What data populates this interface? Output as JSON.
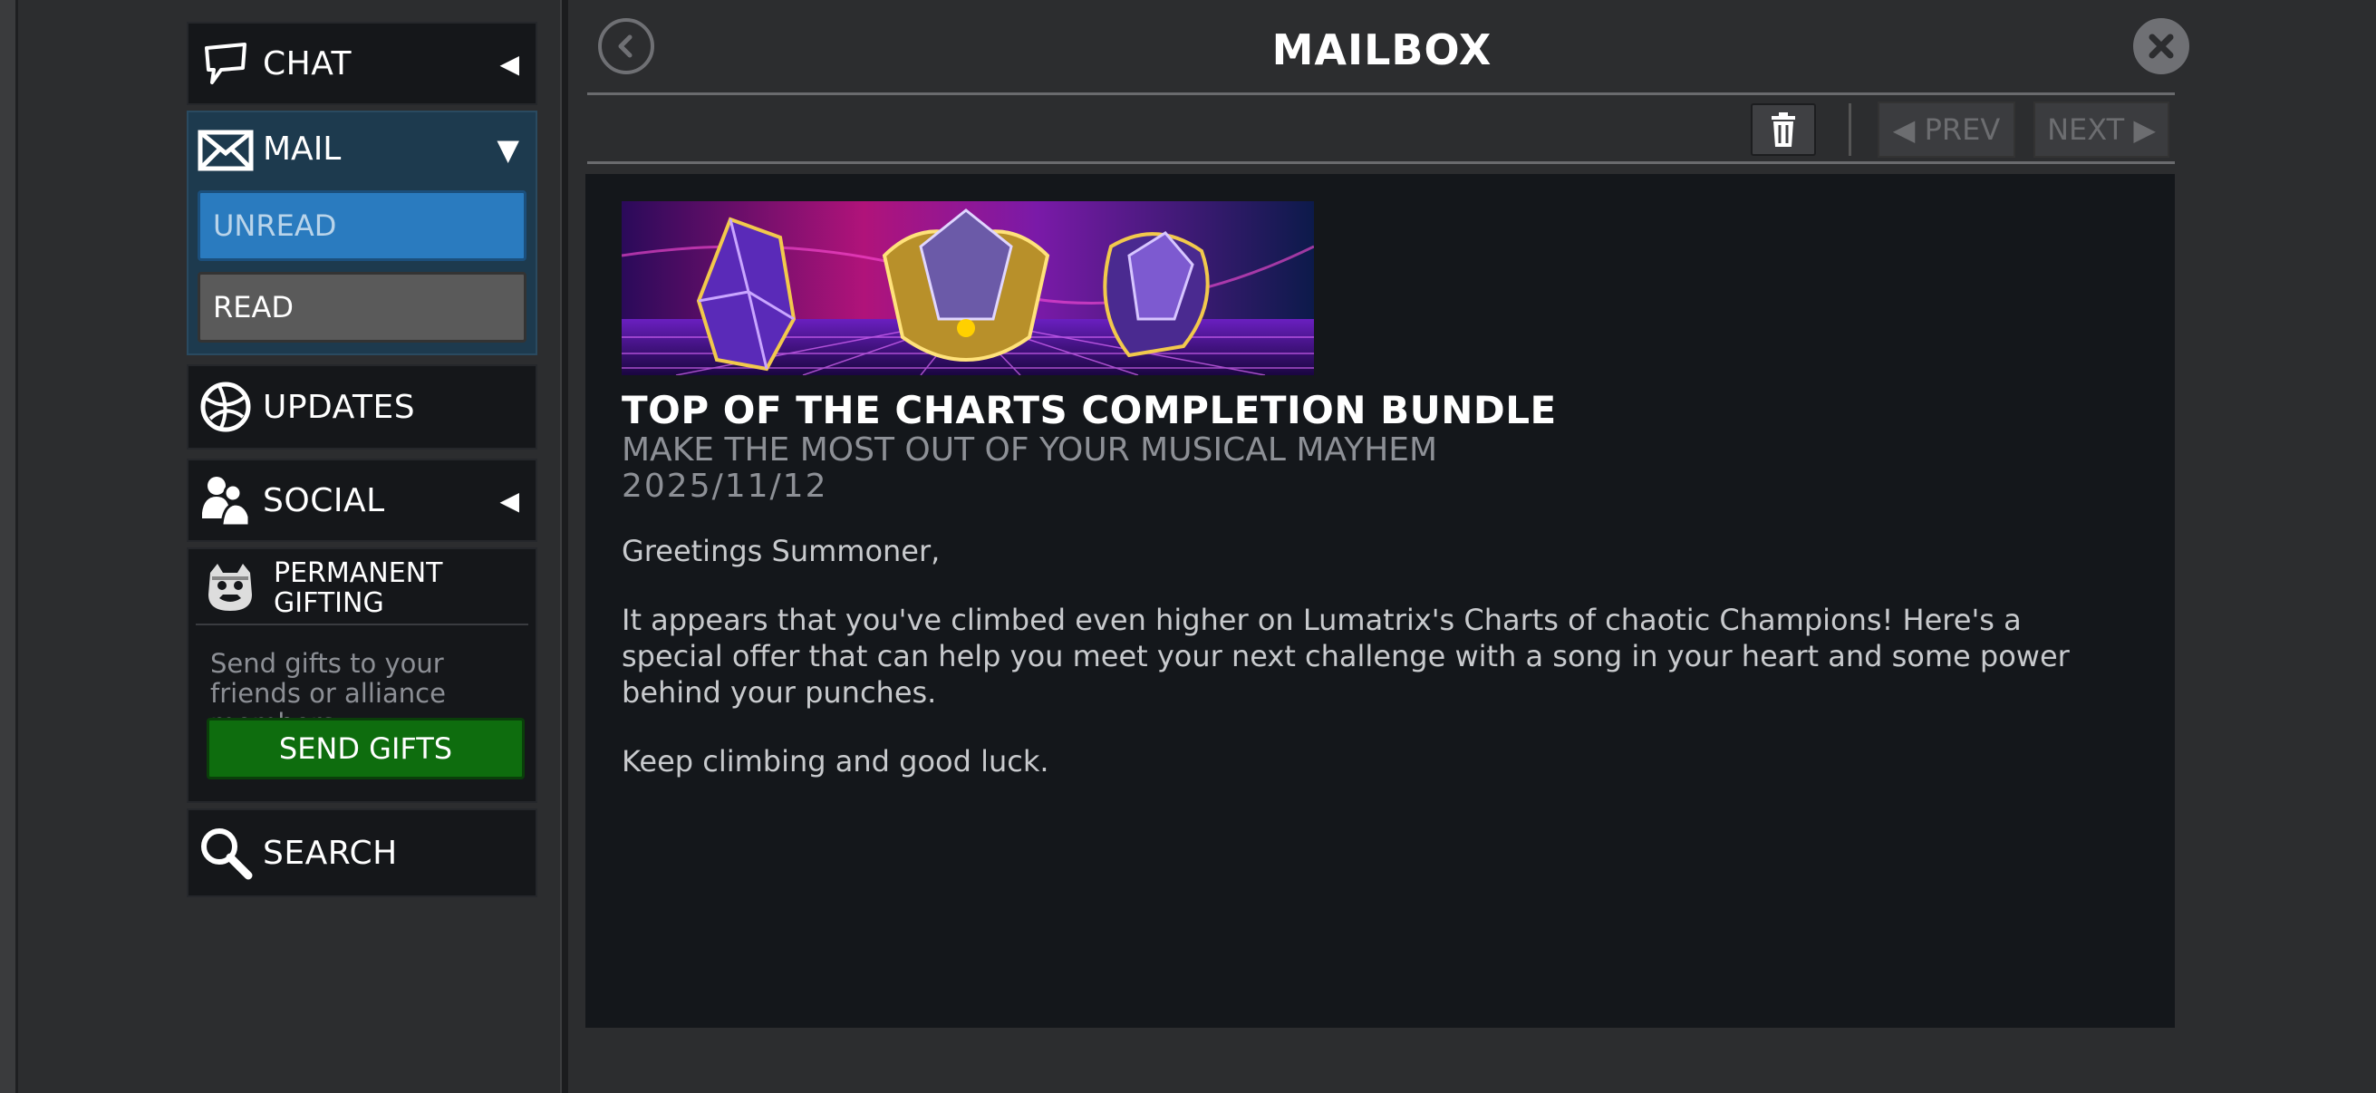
{
  "sidebar": {
    "chat_label": "CHAT",
    "mail_label": "MAIL",
    "unread_label": "UNREAD",
    "read_label": "READ",
    "updates_label": "UPDATES",
    "social_label": "SOCIAL",
    "gifting_title": "PERMANENT GIFTING",
    "gifting_desc": "Send gifts to your friends or alliance members.",
    "send_gifts_label": "SEND GIFTS",
    "search_label": "SEARCH"
  },
  "header": {
    "title": "MAILBOX"
  },
  "toolbar": {
    "prev_label": "◀ PREV",
    "next_label": "NEXT ▶"
  },
  "mail": {
    "title": "TOP OF THE CHARTS COMPLETION BUNDLE",
    "subtitle": "MAKE THE MOST OUT OF YOUR MUSICAL MAYHEM",
    "date": "2025/11/12",
    "greeting": "Greetings Summoner,",
    "paragraph": "It appears that you've climbed even higher on Lumatrix's Charts of chaotic Champions! Here's a special offer that can help you meet your next challenge with a song in your heart and some power behind your punches.",
    "closing": "Keep climbing and good luck."
  },
  "colors": {
    "unread_bg": "#2a7bbf",
    "send_gifts_bg": "#0e6d0e",
    "mail_group_bg": "#1d3a4e",
    "panel_bg": "#14171b"
  }
}
